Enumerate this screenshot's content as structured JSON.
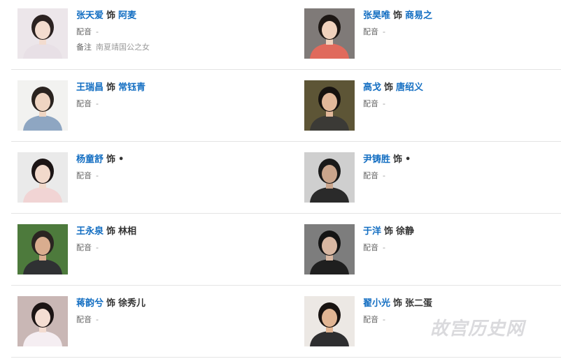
{
  "cast": [
    {
      "actor": "张天爱",
      "plays": "饰",
      "role": "阿麦",
      "role_link": true,
      "dub_label": "配音",
      "dub_value": "-",
      "note_label": "备注",
      "note_value": "南夏靖国公之女",
      "photo": {
        "bg": "#ece6ea",
        "hair": "#2b2221",
        "skin": "#f3dccf",
        "clothes": "#e8e0e6"
      }
    },
    {
      "actor": "张昊唯",
      "plays": "饰",
      "role": "商易之",
      "role_link": true,
      "dub_label": "配音",
      "dub_value": "-",
      "photo": {
        "bg": "#7f7a78",
        "hair": "#1d1714",
        "skin": "#f0d2bd",
        "clothes": "#e06a5c"
      }
    },
    {
      "actor": "王瑞昌",
      "plays": "饰",
      "role": "常钰青",
      "role_link": true,
      "dub_label": "配音",
      "dub_value": "-",
      "photo": {
        "bg": "#f2f2f0",
        "hair": "#2a231f",
        "skin": "#efd5c2",
        "clothes": "#8ea6c2"
      }
    },
    {
      "actor": "高戈",
      "plays": "饰",
      "role": "唐绍义",
      "role_link": true,
      "dub_label": "配音",
      "dub_value": "-",
      "photo": {
        "bg": "#5d5536",
        "hair": "#16120f",
        "skin": "#e2b89a",
        "clothes": "#3b3a36"
      }
    },
    {
      "actor": "杨童舒",
      "plays": "饰",
      "role": "•",
      "role_link": false,
      "dub_label": "配音",
      "dub_value": "-",
      "photo": {
        "bg": "#eaeaea",
        "hair": "#1c1515",
        "skin": "#f2d9cb",
        "clothes": "#f1d4d4"
      }
    },
    {
      "actor": "尹铸胜",
      "plays": "饰",
      "role": "•",
      "role_link": false,
      "dub_label": "配音",
      "dub_value": "-",
      "photo": {
        "bg": "#cfcfcf",
        "hair": "#1a1a1a",
        "skin": "#caa58c",
        "clothes": "#2a2a2a"
      }
    },
    {
      "actor": "王永泉",
      "plays": "饰",
      "role": "林相",
      "role_link": false,
      "dub_label": "配音",
      "dub_value": "-",
      "photo": {
        "bg": "#4d7a3c",
        "hair": "#2a2421",
        "skin": "#d9ad8f",
        "clothes": "#2f3133"
      }
    },
    {
      "actor": "于洋",
      "plays": "饰",
      "role": "徐静",
      "role_link": false,
      "dub_label": "配音",
      "dub_value": "-",
      "photo": {
        "bg": "#7d7d7d",
        "hair": "#141414",
        "skin": "#d8b7a2",
        "clothes": "#1f1f1f"
      }
    },
    {
      "actor": "蒋韵兮",
      "plays": "饰",
      "role": "徐秀儿",
      "role_link": false,
      "dub_label": "配音",
      "dub_value": "-",
      "photo": {
        "bg": "#c9b7b5",
        "hair": "#1b1414",
        "skin": "#f4ddd2",
        "clothes": "#f5eef2"
      }
    },
    {
      "actor": "翟小光",
      "plays": "饰",
      "role": "张二蛋",
      "role_link": false,
      "dub_label": "配音",
      "dub_value": "-",
      "photo": {
        "bg": "#ece8e4",
        "hair": "#181311",
        "skin": "#e1b593",
        "clothes": "#2e2e30"
      }
    }
  ],
  "watermark": "故宫历史网",
  "colors": {
    "link": "#136ec2",
    "text": "#333333",
    "label": "#666666",
    "value": "#999999",
    "divider": "#e4e4e4"
  }
}
